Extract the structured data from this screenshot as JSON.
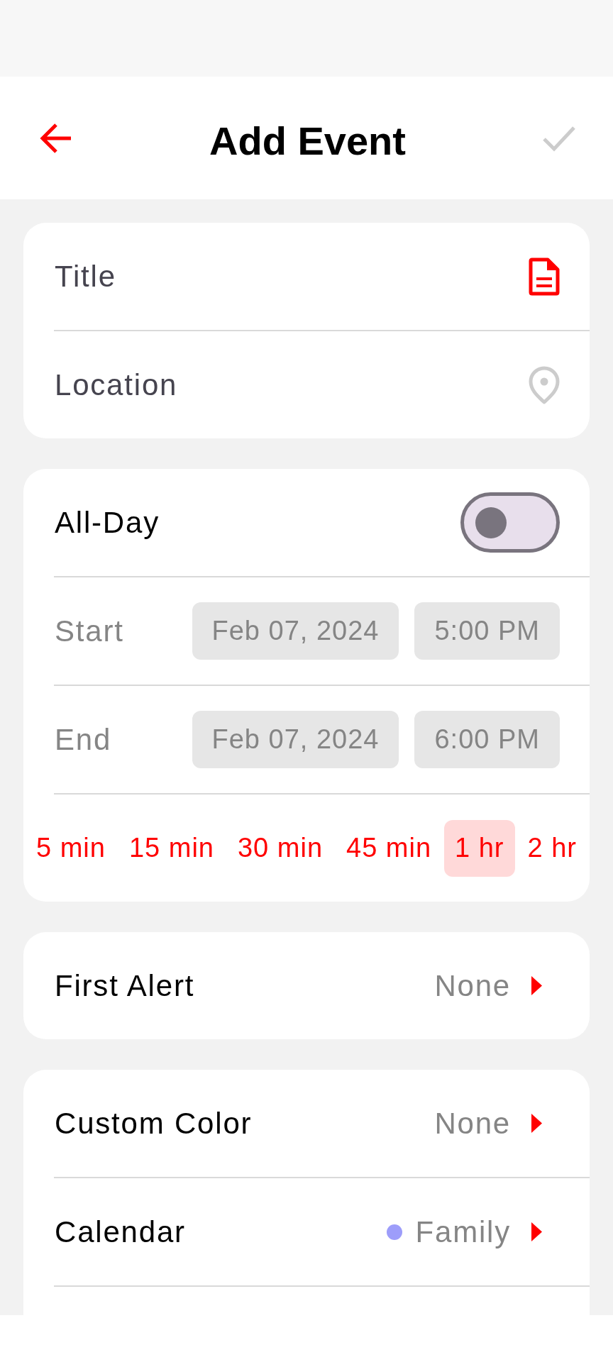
{
  "header": {
    "title": "Add Event",
    "confirm": {
      "disabled": true
    }
  },
  "details": {
    "fields": [
      {
        "kind": "note",
        "placeholder": "Title"
      },
      {
        "kind": "place",
        "placeholder": "Location"
      }
    ]
  },
  "schedule": {
    "all_day": {
      "label": "All-Day",
      "on": false
    },
    "times": [
      {
        "label": "Start",
        "date": "Feb 07, 2024",
        "time": "5:00 PM"
      },
      {
        "label": "End",
        "date": "Feb 07, 2024",
        "time": "6:00 PM"
      }
    ],
    "durations": [
      {
        "label": "5 min",
        "selected": false
      },
      {
        "label": "15 min",
        "selected": false
      },
      {
        "label": "30 min",
        "selected": false
      },
      {
        "label": "45 min",
        "selected": false
      },
      {
        "label": "1 hr",
        "selected": true
      },
      {
        "label": "2 hr",
        "selected": false
      }
    ]
  },
  "settings_cards": [
    {
      "cut_off": false,
      "rows": [
        {
          "label": "First Alert",
          "value": "None"
        }
      ]
    },
    {
      "cut_off": true,
      "rows": [
        {
          "label": "Custom Color",
          "value": "None"
        },
        {
          "label": "Calendar",
          "value": "Family",
          "color": "#9d9dfa"
        }
      ]
    }
  ]
}
